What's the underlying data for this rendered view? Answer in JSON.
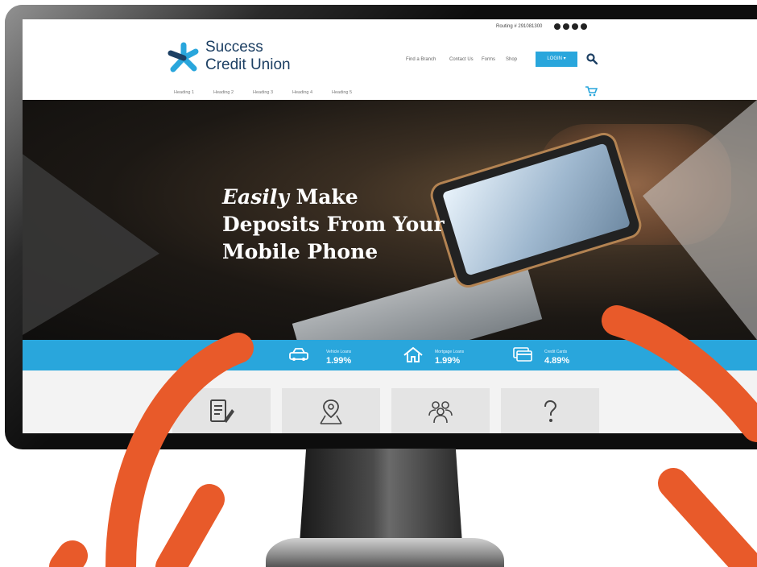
{
  "site": {
    "brand_line1": "Success",
    "brand_line2": "Credit Union",
    "routing": "Routing # 291081300",
    "util_nav": [
      "Find a Branch",
      "Contact Us",
      "Forms",
      "Shop"
    ],
    "login_label": "LOGIN ▾",
    "nav_headings": [
      "Heading 1",
      "Heading 2",
      "Heading 3",
      "Heading 4",
      "Heading 5"
    ]
  },
  "hero": {
    "line1_italic": "Easily",
    "line1_rest": " Make",
    "line2": "Deposits From Your",
    "line3": "Mobile Phone"
  },
  "rates": [
    {
      "icon": "car-icon",
      "label": "Vehicle Loans",
      "value": "1.99%"
    },
    {
      "icon": "house-icon",
      "label": "Mortgage Loans",
      "value": "1.99%"
    },
    {
      "icon": "credit-card-icon",
      "label": "Credit Cards",
      "value": "4.89%"
    }
  ],
  "tiles": [
    "document-pen-icon",
    "map-pin-icon",
    "people-group-icon",
    "question-mark-icon"
  ],
  "colors": {
    "accent": "#29a6dc",
    "brand_navy": "#1c3f63",
    "swoosh": "#e85a2a"
  }
}
